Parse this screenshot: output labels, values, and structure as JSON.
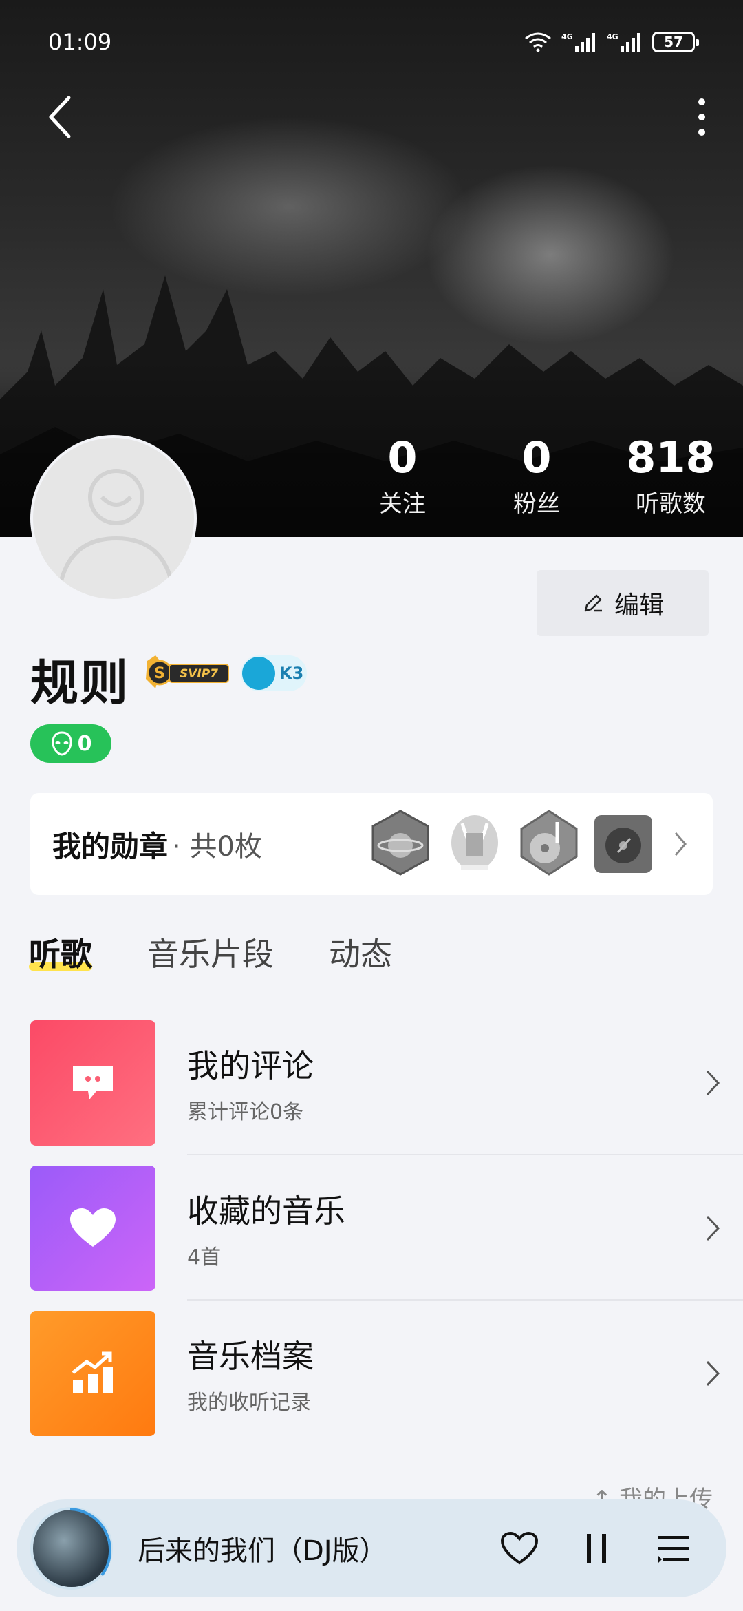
{
  "status_bar": {
    "time": "01:09",
    "battery": "57"
  },
  "profile": {
    "name": "规则",
    "svip_badge": "SVIP7",
    "level_badge": "K3",
    "green_count": "0",
    "edit_label": "编辑"
  },
  "stats": [
    {
      "value": "0",
      "label": "关注"
    },
    {
      "value": "0",
      "label": "粉丝"
    },
    {
      "value": "818",
      "label": "听歌数"
    }
  ],
  "medals": {
    "title": "我的勋章",
    "count": "· 共0枚"
  },
  "tabs": [
    {
      "label": "听歌",
      "active": true
    },
    {
      "label": "音乐片段",
      "active": false
    },
    {
      "label": "动态",
      "active": false
    }
  ],
  "rows": [
    {
      "title": "我的评论",
      "subtitle": "累计评论0条",
      "color": "#fb5f74",
      "icon": "comment-icon"
    },
    {
      "title": "收藏的音乐",
      "subtitle": "4首",
      "color": "#b65cf8",
      "icon": "heart-icon"
    },
    {
      "title": "音乐档案",
      "subtitle": "我的收听记录",
      "color": "#ff8420",
      "icon": "chart-icon"
    }
  ],
  "upload_hint": "↑ 我的上传",
  "player": {
    "song": "后来的我们（DJ版）"
  }
}
